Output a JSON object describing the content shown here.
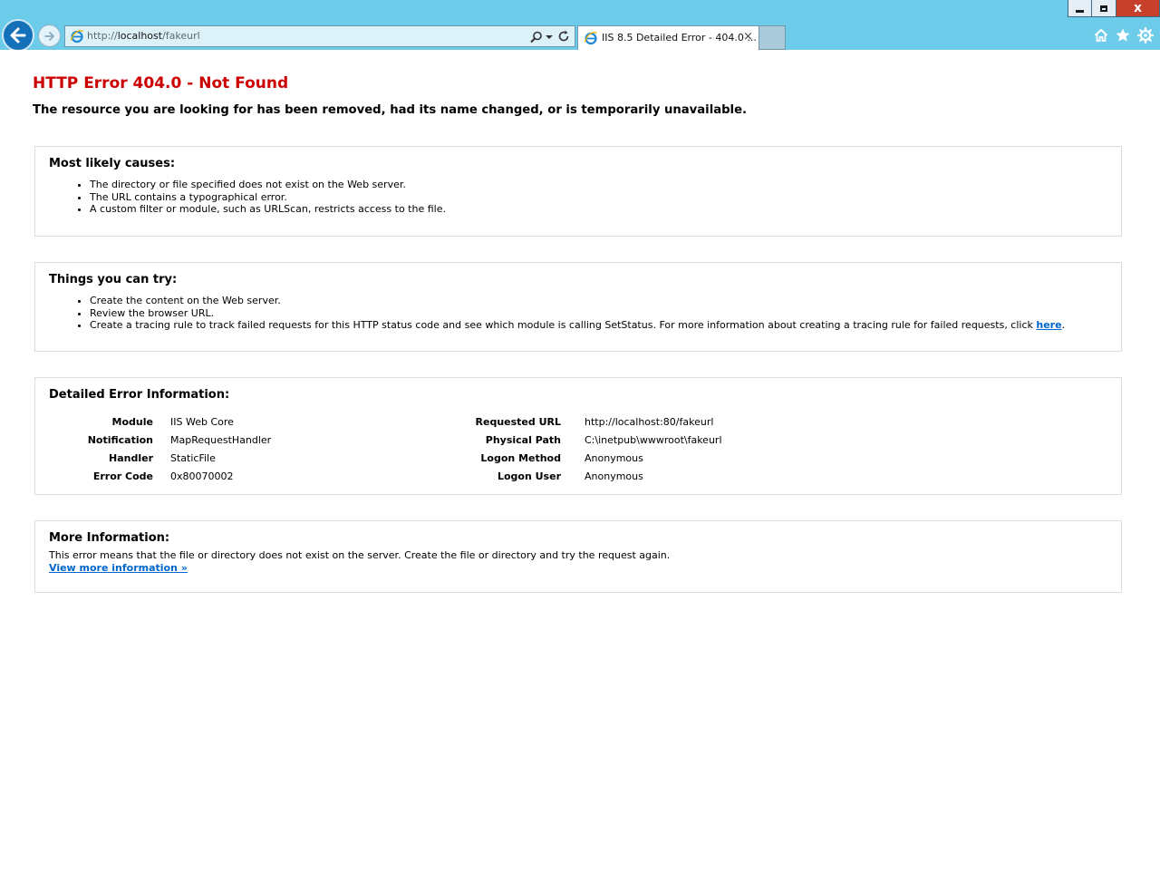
{
  "browser": {
    "address": {
      "prefix": "http://",
      "host": "localhost",
      "path": "/fakeurl"
    },
    "tab": {
      "title": "IIS 8.5 Detailed Error - 404.0 ...",
      "close": "×"
    },
    "window": {
      "close": "x"
    },
    "colors": {
      "chrome": "#6cccea",
      "back_button": "#1470b8",
      "close_button": "#c7402b"
    },
    "icons": [
      "back-arrow-icon",
      "forward-arrow-icon",
      "ie-logo-icon",
      "search-icon",
      "refresh-icon",
      "home-icon",
      "favorites-star-icon",
      "gear-icon"
    ]
  },
  "page": {
    "title": "HTTP Error 404.0 - Not Found",
    "subtitle": "The resource you are looking for has been removed, had its name changed, or is temporarily unavailable.",
    "causes": {
      "heading": "Most likely causes:",
      "items": [
        "The directory or file specified does not exist on the Web server.",
        "The URL contains a typographical error.",
        "A custom filter or module, such as URLScan, restricts access to the file."
      ]
    },
    "try": {
      "heading": "Things you can try:",
      "items": [
        "Create the content on the Web server.",
        "Review the browser URL."
      ],
      "item3_text": "Create a tracing rule to track failed requests for this HTTP status code and see which module is calling SetStatus. For more information about creating a tracing rule for failed requests, click ",
      "item3_link": "here",
      "item3_end": "."
    },
    "details": {
      "heading": "Detailed Error Information:",
      "left": [
        {
          "key": "Module",
          "value": "IIS Web Core"
        },
        {
          "key": "Notification",
          "value": "MapRequestHandler"
        },
        {
          "key": "Handler",
          "value": "StaticFile"
        },
        {
          "key": "Error Code",
          "value": "0x80070002"
        }
      ],
      "right": [
        {
          "key": "Requested URL",
          "value": "http://localhost:80/fakeurl"
        },
        {
          "key": "Physical Path",
          "value": "C:\\inetpub\\wwwroot\\fakeurl"
        },
        {
          "key": "Logon Method",
          "value": "Anonymous"
        },
        {
          "key": "Logon User",
          "value": "Anonymous"
        }
      ]
    },
    "more": {
      "heading": "More Information:",
      "text": "This error means that the file or directory does not exist on the server. Create the file or directory and try the request again.",
      "link": "View more information »"
    },
    "colors": {
      "title": "#cc0000",
      "link": "#0066cc",
      "box_border": "#dddddd"
    }
  }
}
